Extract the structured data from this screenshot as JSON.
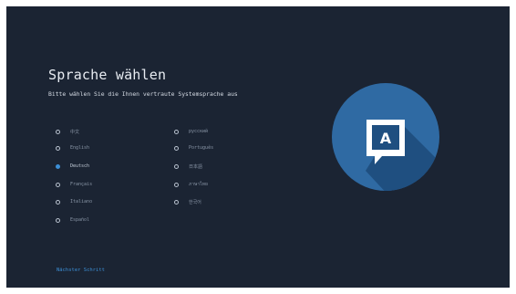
{
  "header": {
    "title": "Sprache wählen",
    "subtitle": "Bitte wählen Sie die Ihnen vertraute Systemsprache aus"
  },
  "languages": {
    "left": [
      {
        "label": "中文",
        "selected": false
      },
      {
        "label": "English",
        "selected": false
      },
      {
        "label": "Deutsch",
        "selected": true
      },
      {
        "label": "Français",
        "selected": false
      },
      {
        "label": "Italiano",
        "selected": false
      },
      {
        "label": "Español",
        "selected": false
      }
    ],
    "right": [
      {
        "label": "русский",
        "selected": false
      },
      {
        "label": "Português",
        "selected": false
      },
      {
        "label": "日本語",
        "selected": false
      },
      {
        "label": "ภาษาไทย",
        "selected": false
      },
      {
        "label": "한국어",
        "selected": false
      }
    ]
  },
  "footer": {
    "next_label": "Nächster Schritt"
  },
  "illustration": {
    "icon": "language-chat-icon",
    "letter": "A"
  },
  "colors": {
    "background": "#1b2433",
    "accent": "#3c8fd6",
    "circle": "#2f6aa3"
  }
}
